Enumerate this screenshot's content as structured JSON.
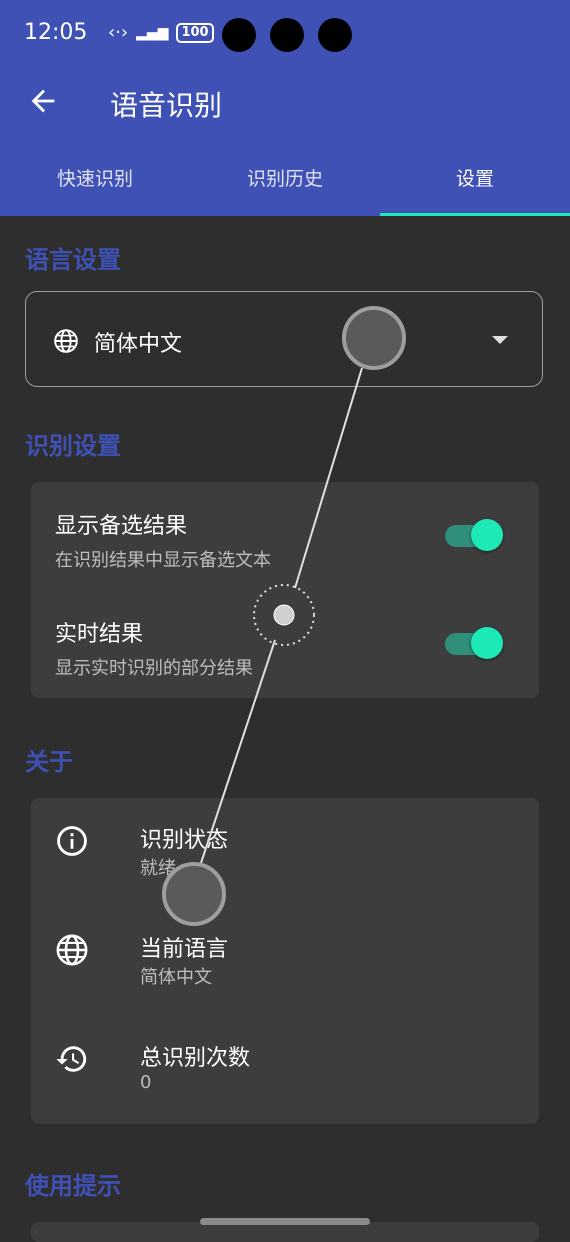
{
  "status": {
    "time": "12:05",
    "battery": "100"
  },
  "header": {
    "title": "语音识别"
  },
  "tabs": [
    {
      "label": "快速识别"
    },
    {
      "label": "识别历史"
    },
    {
      "label": "设置"
    }
  ],
  "language": {
    "section_title": "语言设置",
    "selected": "简体中文"
  },
  "recognition": {
    "section_title": "识别设置",
    "items": [
      {
        "title": "显示备选结果",
        "subtitle": "在识别结果中显示备选文本",
        "enabled": true
      },
      {
        "title": "实时结果",
        "subtitle": "显示实时识别的部分结果",
        "enabled": true
      }
    ]
  },
  "about": {
    "section_title": "关于",
    "items": [
      {
        "icon": "info-icon",
        "title": "识别状态",
        "value": "就绪"
      },
      {
        "icon": "globe-icon",
        "title": "当前语言",
        "value": "简体中文"
      },
      {
        "icon": "history-icon",
        "title": "总识别次数",
        "value": "0"
      }
    ]
  },
  "tips": {
    "section_title": "使用提示"
  },
  "colors": {
    "primary": "#3f51b5",
    "accent": "#1de9b6",
    "background": "#2e2e2e",
    "card": "#3d3d3d"
  }
}
